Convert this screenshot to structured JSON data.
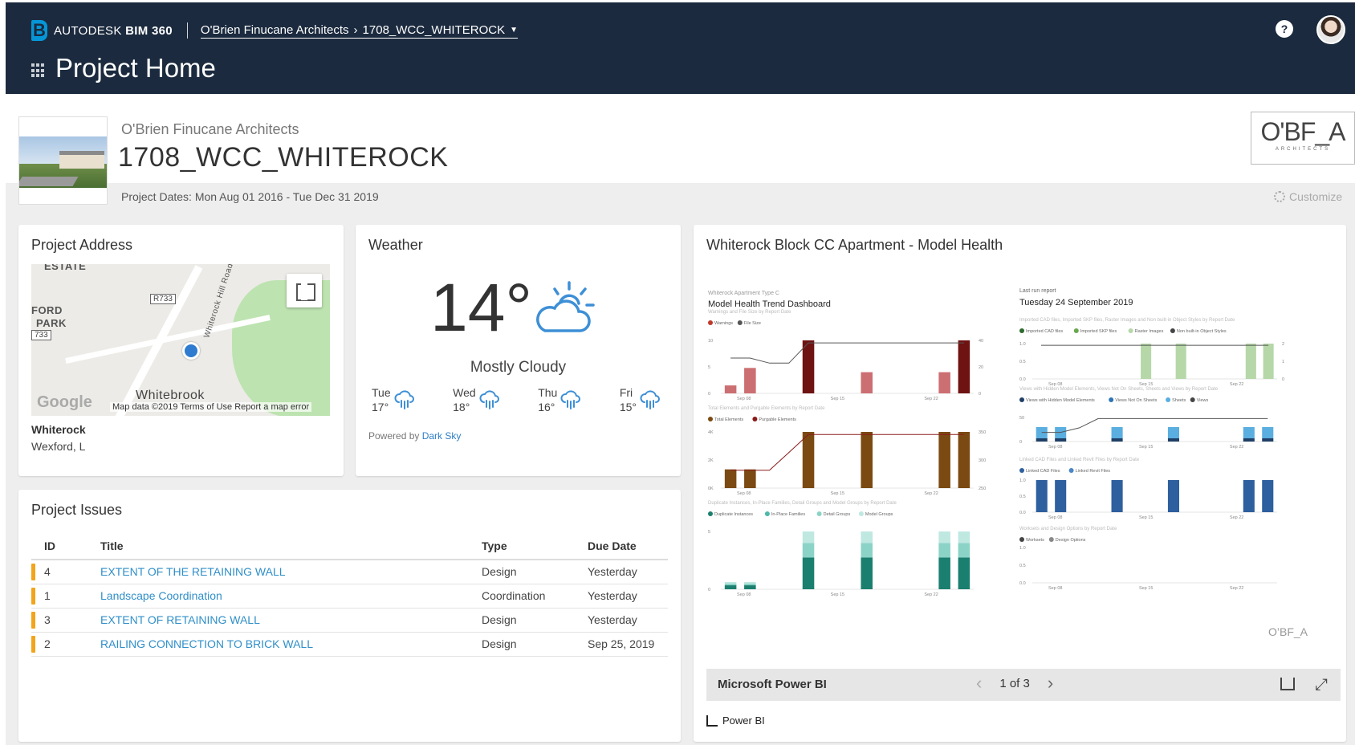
{
  "header": {
    "brand": "AUTODESK",
    "product": "BIM 360",
    "breadcrumb_company": "O'Brien Finucane Architects",
    "breadcrumb_sep": "›",
    "breadcrumb_project": "1708_WCC_WHITEROCK",
    "page_title": "Project Home",
    "help": "?"
  },
  "project": {
    "company": "O'Brien Finucane Architects",
    "name": "1708_WCC_WHITEROCK",
    "dates": "Project Dates: Mon Aug 01 2016 - Tue Dec 31 2019",
    "logo_big": "O'BF_A",
    "logo_small": "ARCHITECTS",
    "customize": "Customize"
  },
  "address": {
    "title": "Project Address",
    "line1": "Whiterock",
    "line2": "Wexford, L",
    "map": {
      "label_estate": "ESTATE",
      "label_ford": "FORD",
      "label_park": "PARK",
      "shield1": "R733",
      "shield2": "733",
      "road": "Whiterock Hill Road",
      "town": "Whitebrook",
      "google": "Google",
      "attribution": "Map data ©2019   Terms of Use   Report a map error"
    }
  },
  "weather": {
    "title": "Weather",
    "temp": "14°",
    "condition": "Mostly Cloudy",
    "forecast": [
      {
        "day": "Tue",
        "temp": "17°",
        "icon": "rain-icon"
      },
      {
        "day": "Wed",
        "temp": "18°",
        "icon": "rain-icon"
      },
      {
        "day": "Thu",
        "temp": "16°",
        "icon": "rain-icon"
      },
      {
        "day": "Fri",
        "temp": "15°",
        "icon": "rain-icon"
      }
    ],
    "powered_prefix": "Powered by",
    "powered_link": "Dark Sky"
  },
  "issues": {
    "title": "Project Issues",
    "columns": [
      "ID",
      "Title",
      "Type",
      "Due Date"
    ],
    "rows": [
      {
        "id": "4",
        "title": "EXTENT OF THE RETAINING WALL",
        "type": "Design",
        "due": "Yesterday",
        "overdue": true
      },
      {
        "id": "1",
        "title": "Landscape Coordination",
        "type": "Coordination",
        "due": "Yesterday",
        "overdue": true
      },
      {
        "id": "3",
        "title": "EXTENT OF RETAINING WALL",
        "type": "Design",
        "due": "Yesterday",
        "overdue": true
      },
      {
        "id": "2",
        "title": "RAILING CONNECTION TO BRICK WALL",
        "type": "Design",
        "due": "Sep 25, 2019",
        "overdue": false
      }
    ]
  },
  "health": {
    "title": "Whiterock Block CC Apartment - Model Health",
    "left_small": "Whiterock Apartment Type C",
    "left_heading": "Model Health Trend Dashboard",
    "right_small": "Last run report",
    "right_heading": "Tuesday 24 September 2019",
    "footer_brand": "Microsoft Power BI",
    "pager": "1 of 3",
    "powerbi": "Power BI",
    "panels": [
      {
        "title": "Warnings and File Size by Report Date",
        "legend": [
          "Warnings",
          "File Size"
        ],
        "colors": [
          "#c0392b",
          "#555555"
        ],
        "ticks_x": [
          "Sep 08",
          "Sep 15",
          "Sep 22"
        ],
        "ticks_y": [
          "10",
          "5",
          "0"
        ],
        "ticks_y2": [
          "40",
          "20",
          "0"
        ],
        "values": [
          1.5,
          4.8,
          0,
          0,
          10,
          0,
          0,
          4,
          0,
          0,
          0,
          4,
          10
        ],
        "dark": [
          false,
          false,
          false,
          false,
          true,
          false,
          false,
          false,
          false,
          false,
          false,
          false,
          true
        ],
        "line": [
          7,
          7,
          6,
          6,
          10,
          10,
          10,
          10,
          10,
          10,
          10,
          10,
          10
        ]
      },
      {
        "title": "Total Elements and Purgable Elements by Report Date",
        "legend": [
          "Total Elements",
          "Purgable Elements"
        ],
        "colors": [
          "#7b4a12",
          "#8b1a1a"
        ],
        "ticks_x": [
          "Sep 08",
          "Sep 15",
          "Sep 22"
        ],
        "ticks_y": [
          "4K",
          "2K",
          "0K"
        ],
        "ticks_y2": [
          "350",
          "300",
          "250"
        ],
        "values": [
          2,
          2,
          0,
          0,
          6,
          0,
          0,
          6,
          0,
          0,
          0,
          6,
          6
        ],
        "line": [
          2,
          2,
          2,
          4,
          6,
          6,
          6,
          6,
          6,
          6,
          6,
          6,
          6
        ]
      },
      {
        "title": "Duplicate Instances, In-Place Families, Detail Groups and Model Groups by Report Date",
        "legend": [
          "Duplicate Instances",
          "In-Place Families",
          "Detail Groups",
          "Model Groups"
        ],
        "colors": [
          "#1a7f6e",
          "#4cb8a8",
          "#8bd3c7",
          "#bfe8e1"
        ],
        "ticks_x": [
          "Sep 08",
          "Sep 15",
          "Sep 22"
        ],
        "ticks_y": [
          "5",
          "0"
        ],
        "values": [
          1,
          1,
          0,
          0,
          8,
          0,
          0,
          8,
          0,
          0,
          0,
          8,
          8
        ]
      },
      {
        "title": "Imported CAD files, Imported SKP files, Raster Images and Non built-in Object Styles by Report Date",
        "legend": [
          "Imported CAD files",
          "Imported SKP files",
          "Raster Images",
          "Non built-in Object Styles"
        ],
        "colors": [
          "#2d6a2d",
          "#6aa84f",
          "#b6d7a8",
          "#444444"
        ],
        "ticks_x": [
          "Sep 08",
          "Sep 15",
          "Sep 22"
        ],
        "ticks_y": [
          "1.0",
          "0.5",
          "0.0"
        ],
        "ticks_y2": [
          "2",
          "1",
          "0"
        ],
        "values": [
          0,
          0,
          0,
          0,
          0,
          0,
          2,
          0,
          2,
          0,
          0,
          0,
          2,
          2
        ],
        "line": [
          1,
          1,
          1,
          1,
          1,
          1,
          1,
          1,
          1,
          1,
          1,
          1,
          1,
          1
        ]
      },
      {
        "title": "Views with Hidden Model Elements, Views Not On Sheets, Sheets and Views by Report Date",
        "legend": [
          "Views with Hidden Model Elements",
          "Views Not On Sheets",
          "Sheets",
          "Views"
        ],
        "colors": [
          "#1f3f66",
          "#2e75b6",
          "#5aaee0",
          "#444444"
        ],
        "ticks_x": [
          "Sep 08",
          "Sep 15",
          "Sep 22"
        ],
        "ticks_y": [
          "50",
          "0"
        ],
        "values": [
          1,
          1,
          0,
          0,
          1,
          0,
          0,
          1,
          0,
          0,
          0,
          1,
          1
        ],
        "line": [
          2,
          2,
          3,
          5,
          5,
          5,
          5,
          5,
          5,
          5,
          5,
          5,
          5
        ]
      },
      {
        "title": "Linked CAD Files and Linked Revit Files by Report Date",
        "legend": [
          "Linked CAD Files",
          "Linked Revit Files"
        ],
        "colors": [
          "#2e5f9e",
          "#4a86c8"
        ],
        "ticks_x": [
          "Sep 08",
          "Sep 15",
          "Sep 22"
        ],
        "ticks_y": [
          "1.0",
          "0.5",
          "0.0"
        ],
        "values": [
          1,
          1,
          0,
          0,
          1,
          0,
          0,
          1,
          0,
          0,
          0,
          1,
          1
        ]
      },
      {
        "title": "Worksets and Design Options by Report Date",
        "legend": [
          "Worksets",
          "Design Options"
        ],
        "colors": [
          "#444444",
          "#888888"
        ],
        "ticks_x": [
          "Sep 08",
          "Sep 15",
          "Sep 22"
        ],
        "ticks_y": [
          "1.0",
          "0.5",
          "0.0"
        ],
        "values": []
      }
    ]
  }
}
